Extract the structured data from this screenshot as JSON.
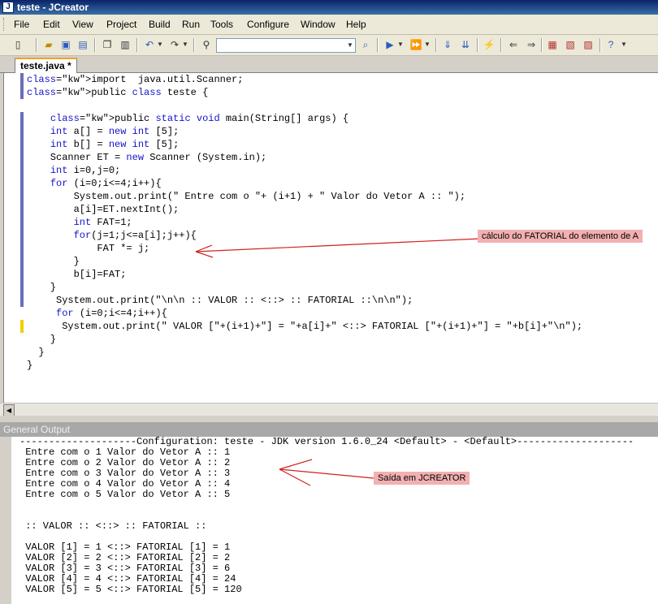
{
  "window": {
    "title": "teste - JCreator"
  },
  "menu": [
    "File",
    "Edit",
    "View",
    "Project",
    "Build",
    "Run",
    "Tools",
    "Configure",
    "Window",
    "Help"
  ],
  "toolbar": {
    "icons": [
      "new-file-icon",
      "open-icon",
      "save-icon",
      "save-all-icon",
      "copy-icon",
      "paste-icon",
      "undo-icon",
      "redo-icon",
      "find-icon",
      "find-in-files-icon",
      "run-icon",
      "run-project-icon",
      "compile-file-icon",
      "compile-project-icon",
      "debug-icon",
      "back-icon",
      "forward-icon",
      "window-icon",
      "project-icon",
      "help-icon"
    ],
    "search_value": ""
  },
  "tab": {
    "label": "teste.java *"
  },
  "editor": {
    "code": [
      "import  java.util.Scanner;",
      "public class teste {",
      "",
      "    public static void main(String[] args) {",
      "    int a[] = new int [5];",
      "    int b[] = new int [5];",
      "    Scanner ET = new Scanner (System.in);",
      "    int i=0,j=0;",
      "    for (i=0;i<=4;i++){",
      "        System.out.print(\" Entre com o \"+ (i+1) + \" Valor do Vetor A :: \");",
      "        a[i]=ET.nextInt();",
      "        int FAT=1;",
      "        for(j=1;j<=a[i];j++){",
      "            FAT *= j;",
      "        }",
      "        b[i]=FAT;",
      "    }",
      "     System.out.print(\"\\n\\n :: VALOR :: <::> :: FATORIAL ::\\n\\n\");",
      "     for (i=0;i<=4;i++){",
      "      System.out.print(\" VALOR [\"+(i+1)+\"] = \"+a[i]+\" <::> FATORIAL [\"+(i+1)+\"] = \"+b[i]+\"\\n\");",
      "    }",
      "  }",
      "}"
    ]
  },
  "annotations": {
    "code_note": "cálculo do FATORIAL do elemento de A",
    "output_note": "Saída em JCREATOR"
  },
  "output": {
    "header": "General Output",
    "lines": [
      "--------------------Configuration: teste - JDK version 1.6.0_24 <Default> - <Default>--------------------",
      " Entre com o 1 Valor do Vetor A :: 1",
      " Entre com o 2 Valor do Vetor A :: 2",
      " Entre com o 3 Valor do Vetor A :: 3",
      " Entre com o 4 Valor do Vetor A :: 4",
      " Entre com o 5 Valor do Vetor A :: 5",
      "",
      "",
      " :: VALOR :: <::> :: FATORIAL ::",
      "",
      " VALOR [1] = 1 <::> FATORIAL [1] = 1",
      " VALOR [2] = 2 <::> FATORIAL [2] = 2",
      " VALOR [3] = 3 <::> FATORIAL [3] = 6",
      " VALOR [4] = 4 <::> FATORIAL [4] = 24",
      " VALOR [5] = 5 <::> FATORIAL [5] = 120"
    ]
  }
}
